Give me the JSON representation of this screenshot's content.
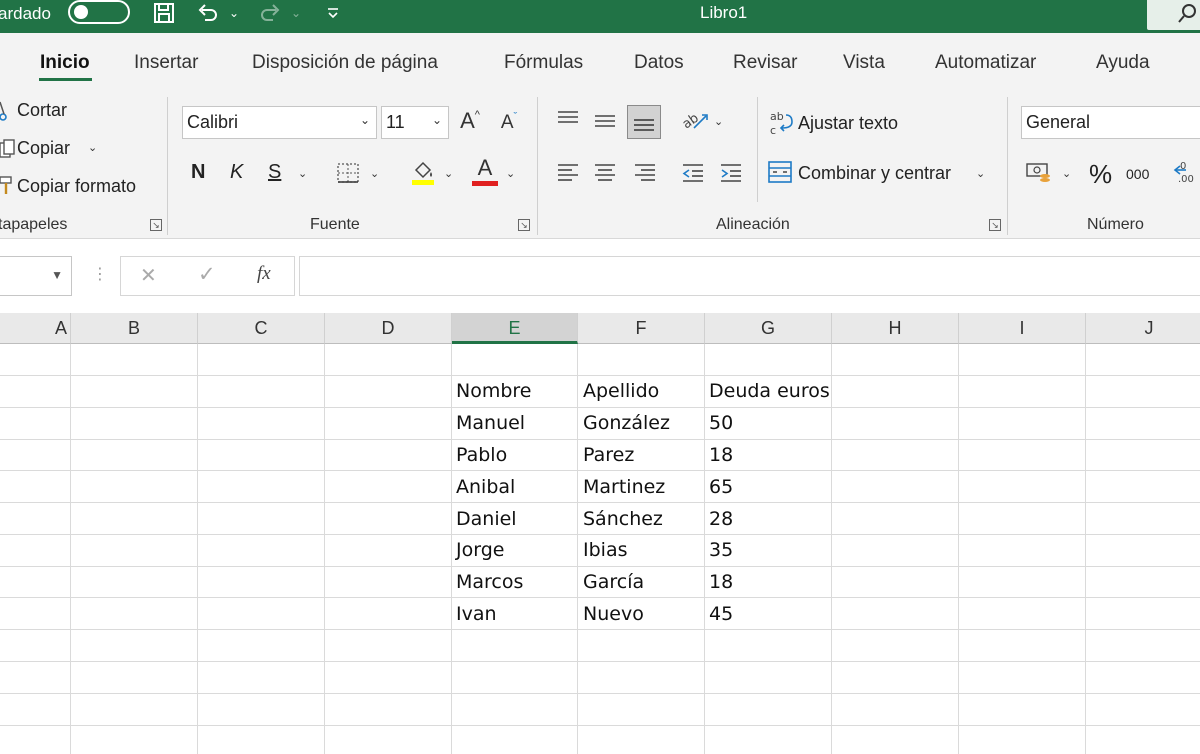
{
  "titlebar": {
    "autosave_label": "ardado",
    "doc_title": "Libro1"
  },
  "tabs": [
    "Inicio",
    "Insertar",
    "Disposición de página",
    "Fórmulas",
    "Datos",
    "Revisar",
    "Vista",
    "Automatizar",
    "Ayuda"
  ],
  "ribbon": {
    "clipboard": {
      "cut": "Cortar",
      "copy": "Copiar",
      "format_painter": "Copiar formato",
      "label": "tapapeles"
    },
    "font": {
      "name": "Calibri",
      "size": "11",
      "bold": "N",
      "italic": "K",
      "underline": "S",
      "label": "Fuente"
    },
    "alignment": {
      "wrap_text": "Ajustar texto",
      "merge_center": "Combinar y centrar",
      "label": "Alineación"
    },
    "number": {
      "format": "General",
      "percent": "%",
      "thousands": "000",
      "label": "Número"
    }
  },
  "formula_bar": {
    "fx": "fx",
    "cancel": "✕",
    "enter": "✓"
  },
  "columns": [
    "A",
    "B",
    "C",
    "D",
    "E",
    "F",
    "G",
    "H",
    "I",
    "J"
  ],
  "selected_column": "E",
  "sheet": {
    "headers": [
      "Nombre",
      "Apellido",
      "Deuda euros"
    ],
    "rows": [
      [
        "Manuel",
        "González",
        "50"
      ],
      [
        "Pablo",
        "Parez",
        "18"
      ],
      [
        "Anibal",
        "Martinez",
        "65"
      ],
      [
        "Daniel",
        "Sánchez",
        "28"
      ],
      [
        "Jorge",
        "Ibias",
        "35"
      ],
      [
        "Marcos",
        "García",
        "18"
      ],
      [
        "Ivan",
        "Nuevo",
        "45"
      ]
    ]
  },
  "colors": {
    "excel_green": "#217346",
    "font_color_red": "#e02020",
    "highlight_yellow": "#ffff00"
  }
}
